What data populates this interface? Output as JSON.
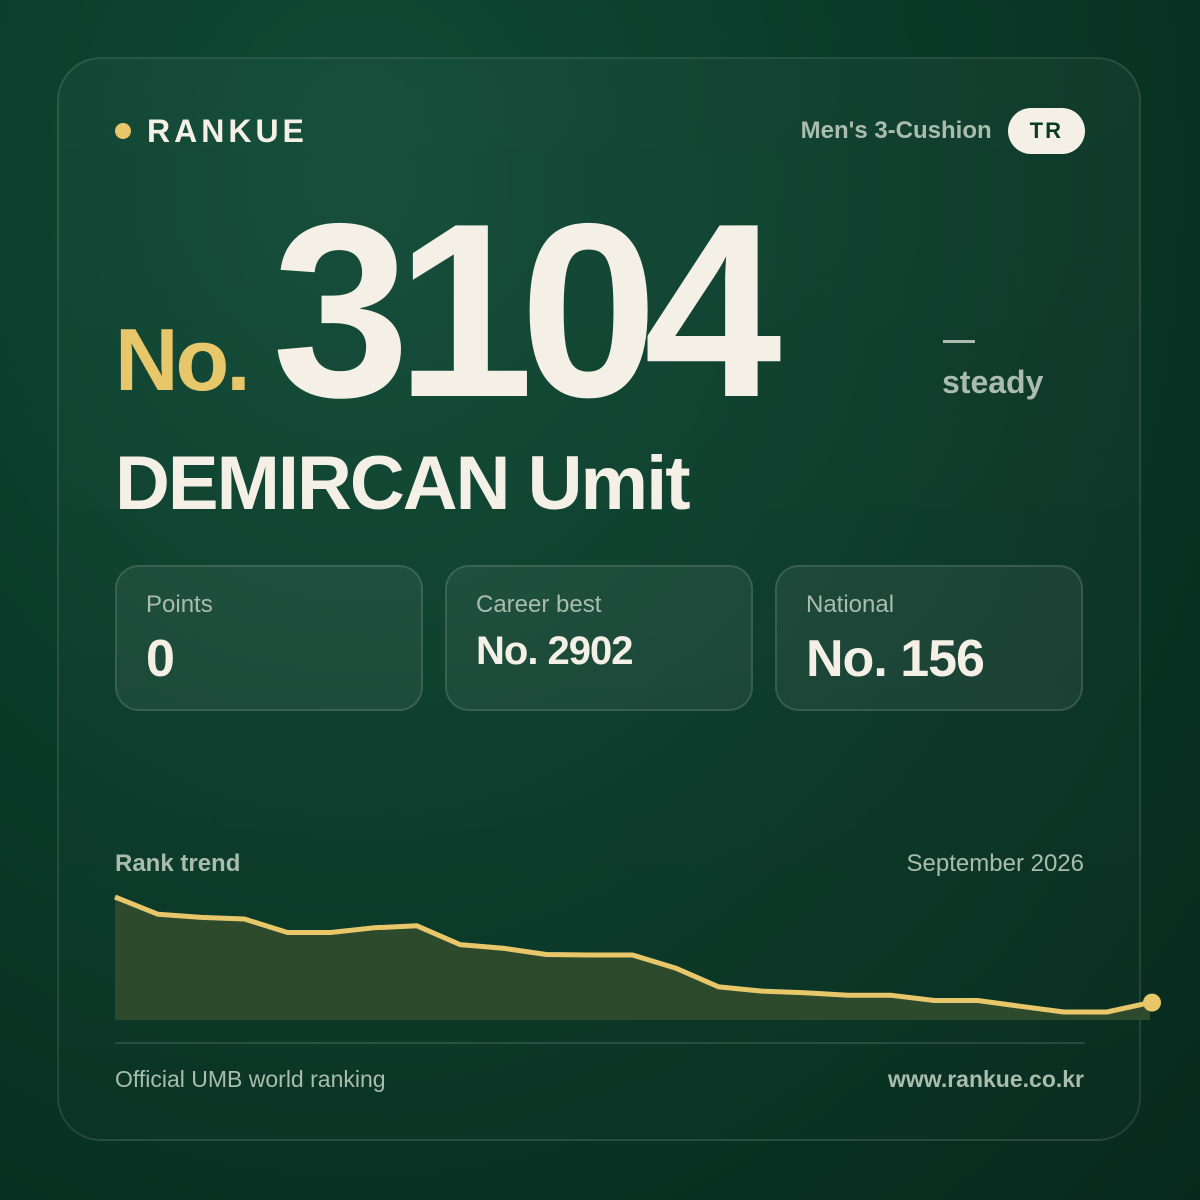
{
  "brand": {
    "name": "RANKUE"
  },
  "header": {
    "discipline": "Men's 3-Cushion",
    "country": "TR"
  },
  "rank": {
    "prefix": "No.",
    "number": "3104",
    "trend_icon": "dash-icon",
    "trend": "steady"
  },
  "player": {
    "name": "DEMIRCAN Umit"
  },
  "stats": [
    {
      "label": "Points",
      "value": "0"
    },
    {
      "label": "Career best",
      "value": "No. 2902"
    },
    {
      "label": "National",
      "value": "No. 156"
    }
  ],
  "trend": {
    "title": "Rank trend",
    "date": "September 2026"
  },
  "chart_data": {
    "type": "area",
    "title": "Rank trend",
    "y_axis": "rank (inverted: higher rank plotted lower)",
    "values": [
      2902,
      2935,
      2941,
      2944,
      2970,
      2970,
      2961,
      2957,
      2993,
      3000,
      3012,
      3013,
      3013,
      3038,
      3074,
      3082,
      3085,
      3090,
      3090,
      3100,
      3100,
      3111,
      3122,
      3122,
      3104
    ],
    "ylim": [
      2902,
      3122
    ],
    "grid": false,
    "legend": "none",
    "colors": {
      "line": "#e8c66a",
      "fill": "#2d4a2c"
    }
  },
  "footer": {
    "left": "Official UMB world ranking",
    "right": "www.rankue.co.kr"
  },
  "colors": {
    "accent": "#e8c66a",
    "cream": "#f4f0e6",
    "muted": "#a9bcae",
    "background": "#0a3a29"
  }
}
